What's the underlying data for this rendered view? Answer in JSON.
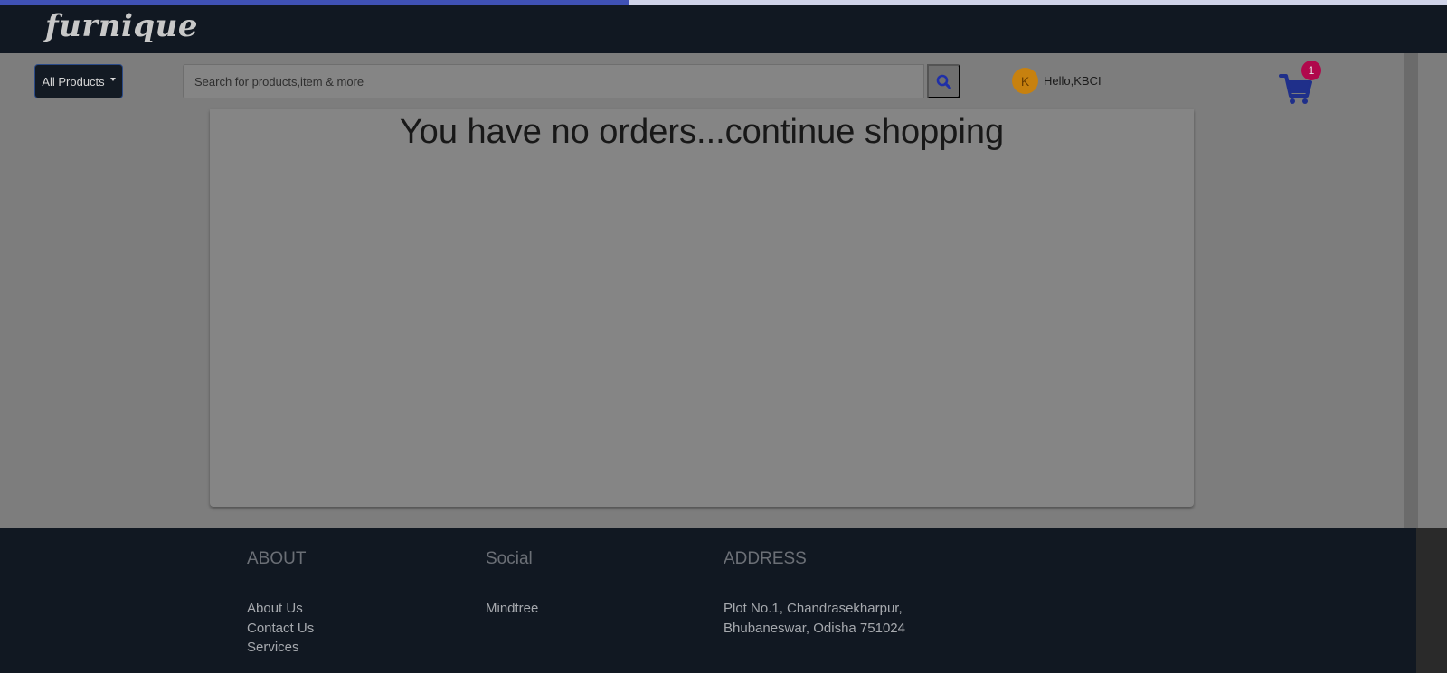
{
  "progress": {
    "fraction": 0.435,
    "color": "#3f51b5"
  },
  "brand": {
    "logo_text": "furnique"
  },
  "nav": {
    "all_products_label": "All Products",
    "search_placeholder": "Search for products,item & more",
    "search_icon": "search-icon",
    "user": {
      "avatar_initial": "K",
      "greeting": "Hello,KBCI"
    },
    "cart": {
      "icon": "cart-icon",
      "count": "1"
    }
  },
  "main": {
    "empty_message": "You have no orders...continue shopping"
  },
  "footer": {
    "about": {
      "title": "ABOUT",
      "links": [
        "About Us",
        "Contact Us",
        "Services"
      ]
    },
    "social": {
      "title": "Social",
      "links": [
        "Mindtree"
      ]
    },
    "address": {
      "title": "ADDRESS",
      "line1": "Plot No.1, Chandrasekharpur,",
      "line2": "Bhubaneswar, Odisha 751024"
    }
  },
  "colors": {
    "accent": "#3f51b5",
    "badge": "#b0094c",
    "avatar": "#c7810f",
    "header_bg": "#111822"
  }
}
